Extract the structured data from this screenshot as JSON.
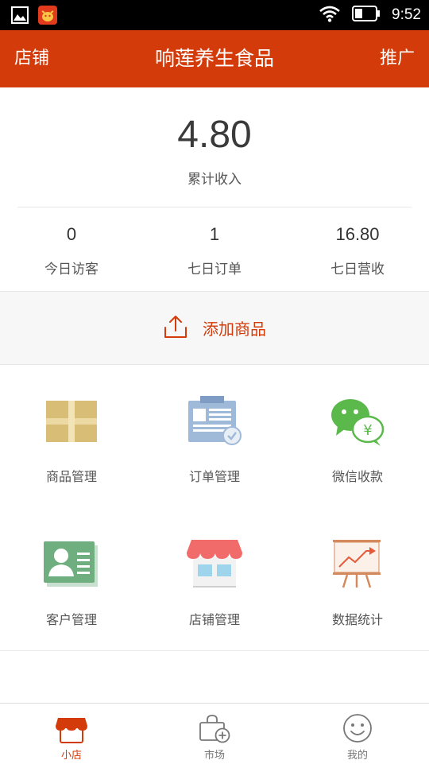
{
  "status_bar": {
    "time": "9:52"
  },
  "header": {
    "left_label": "店铺",
    "title": "响莲养生食品",
    "right_label": "推广"
  },
  "income": {
    "value": "4.80",
    "label": "累计收入"
  },
  "stats": [
    {
      "value": "0",
      "label": "今日访客"
    },
    {
      "value": "1",
      "label": "七日订单"
    },
    {
      "value": "16.80",
      "label": "七日营收"
    }
  ],
  "add_product": {
    "label": "添加商品"
  },
  "grid": [
    {
      "label": "商品管理",
      "icon": "box-icon"
    },
    {
      "label": "订单管理",
      "icon": "clipboard-icon"
    },
    {
      "label": "微信收款",
      "icon": "wechat-pay-icon"
    },
    {
      "label": "客户管理",
      "icon": "contact-card-icon"
    },
    {
      "label": "店铺管理",
      "icon": "storefront-icon"
    },
    {
      "label": "数据统计",
      "icon": "chart-board-icon"
    }
  ],
  "bottom_nav": [
    {
      "label": "小店",
      "active": true
    },
    {
      "label": "市场",
      "active": false
    },
    {
      "label": "我的",
      "active": false
    }
  ],
  "colors": {
    "brand": "#d43b0a",
    "status_bar": "#000000"
  }
}
